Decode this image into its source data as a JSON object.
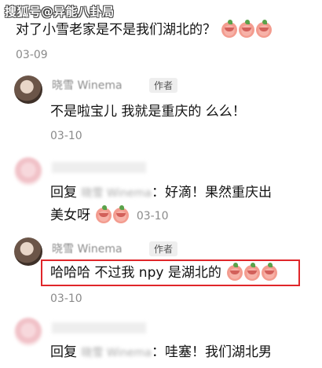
{
  "watermark": "搜狐号@异能八卦局",
  "comments": [
    {
      "text": "对了小雪老家是不是我们湖北的？",
      "date": "03-09"
    },
    {
      "name": "晓雪 Winema",
      "author_tag": "作者",
      "text": "不是啦宝儿 我就是重庆的 么么！",
      "date": "03-10"
    },
    {
      "reply_prefix": "回复",
      "reply_target": "晓雪 Winema",
      "text_line1": "：好滴！果然重庆出",
      "text_line2": "美女呀",
      "date": "03-10"
    },
    {
      "name": "晓雪 Winema",
      "author_tag": "作者",
      "text": "哈哈哈  不过我 npy 是湖北的",
      "date": "03-10"
    },
    {
      "reply_prefix": "回复",
      "reply_target": "晓雪 Winema",
      "text": "：哇塞！我们湖北男"
    }
  ]
}
